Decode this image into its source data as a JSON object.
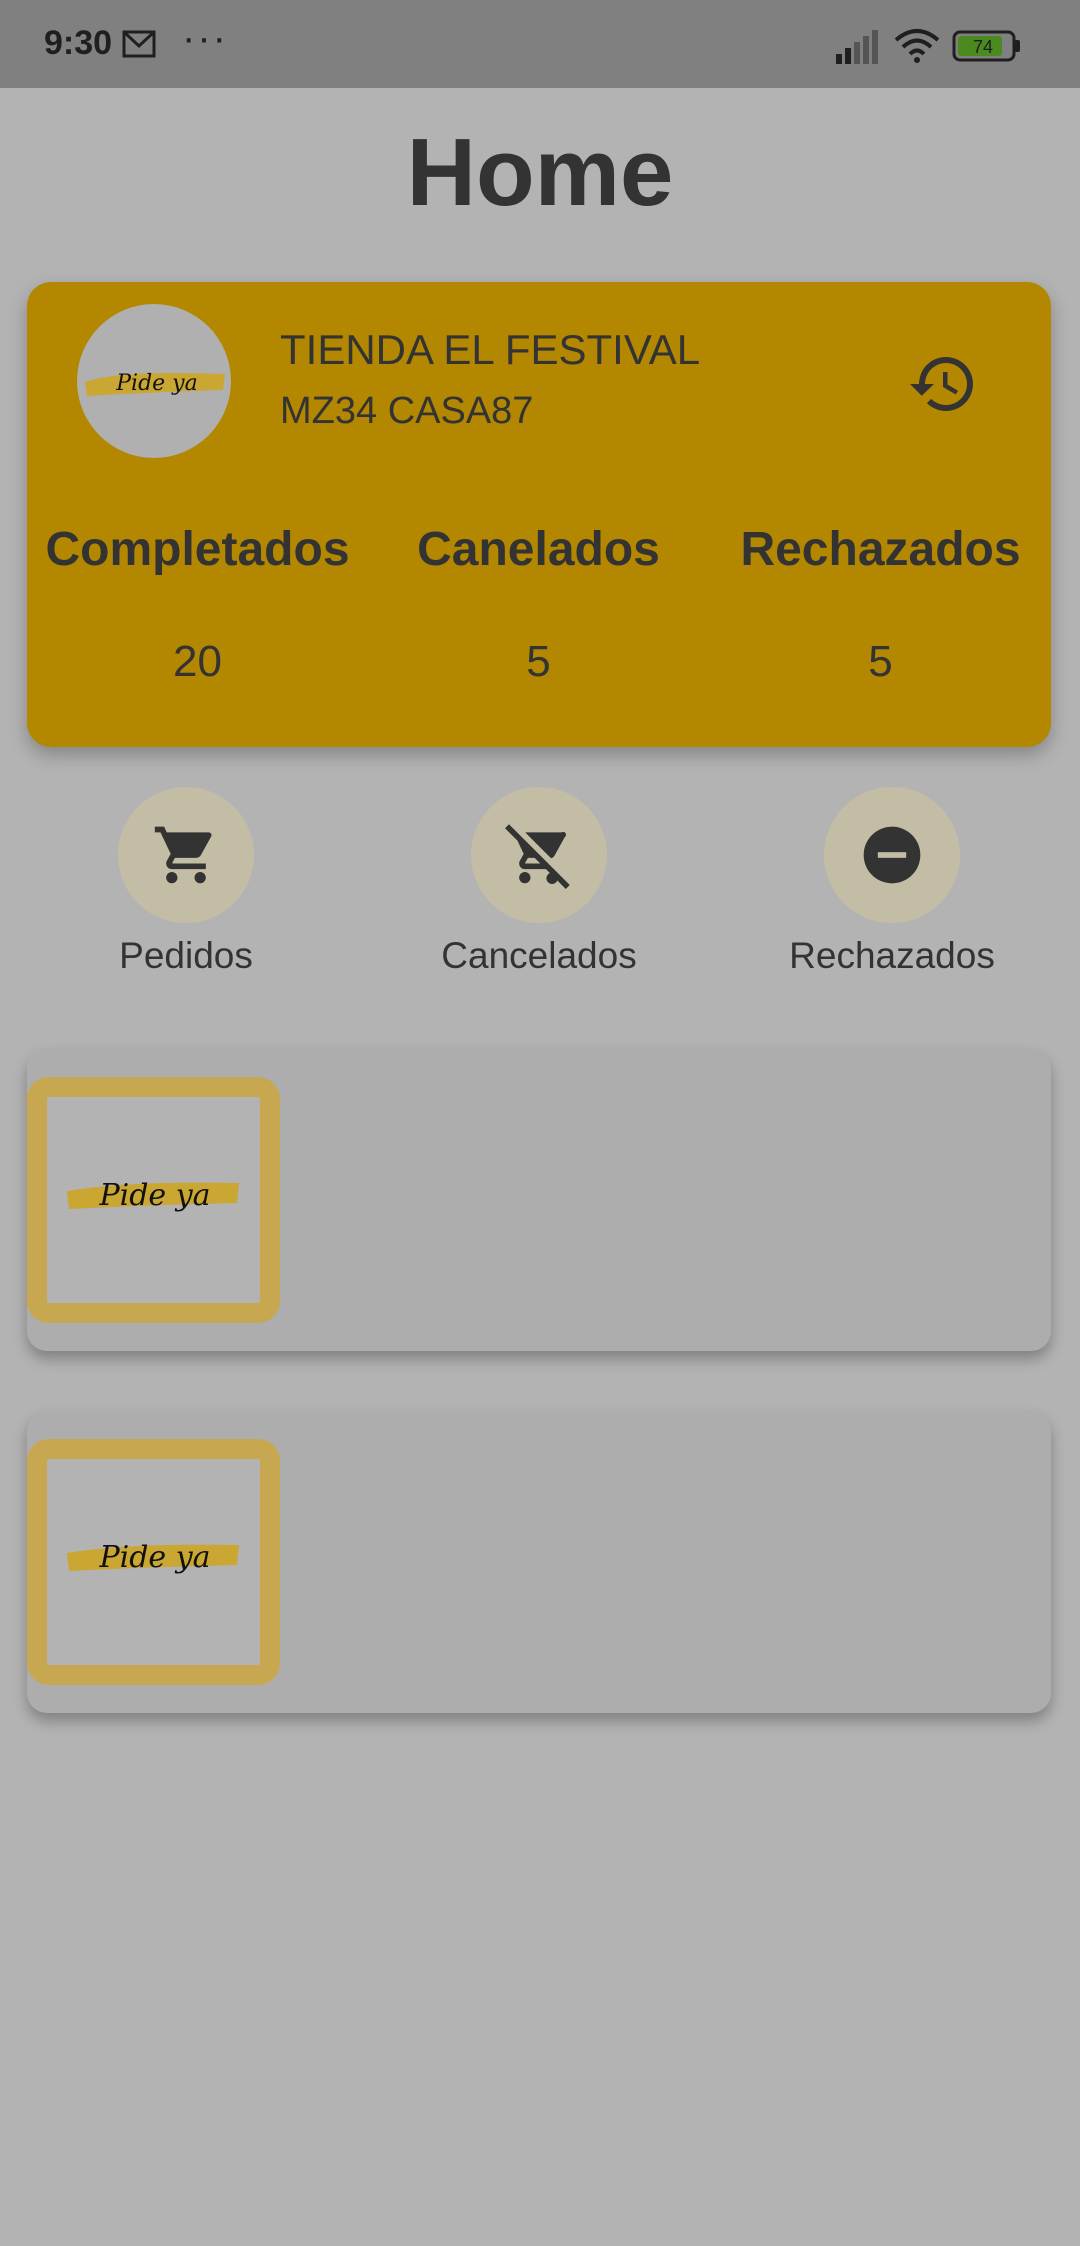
{
  "status_bar": {
    "time": "9:30",
    "more": "···",
    "battery": "74",
    "icons": [
      "mail-icon",
      "signal-icon",
      "wifi-icon",
      "battery-icon"
    ]
  },
  "page": {
    "title": "Home"
  },
  "store": {
    "name": "TIENDA EL FESTIVAL",
    "address": "MZ34 CASA87",
    "logo_text": "Pide ya",
    "history_icon": "history-icon",
    "accent": "#b38700"
  },
  "stats": [
    {
      "label": "Completados",
      "value": "20"
    },
    {
      "label": "Canelados",
      "value": "5"
    },
    {
      "label": "Rechazados",
      "value": "5"
    }
  ],
  "actions": [
    {
      "label": "Pedidos",
      "icon": "cart-icon"
    },
    {
      "label": "Cancelados",
      "icon": "cart-off-icon"
    },
    {
      "label": "Rechazados",
      "icon": "block-icon"
    }
  ],
  "orders": [
    {
      "thumb_text": "Pide ya"
    },
    {
      "thumb_text": "Pide ya"
    }
  ]
}
